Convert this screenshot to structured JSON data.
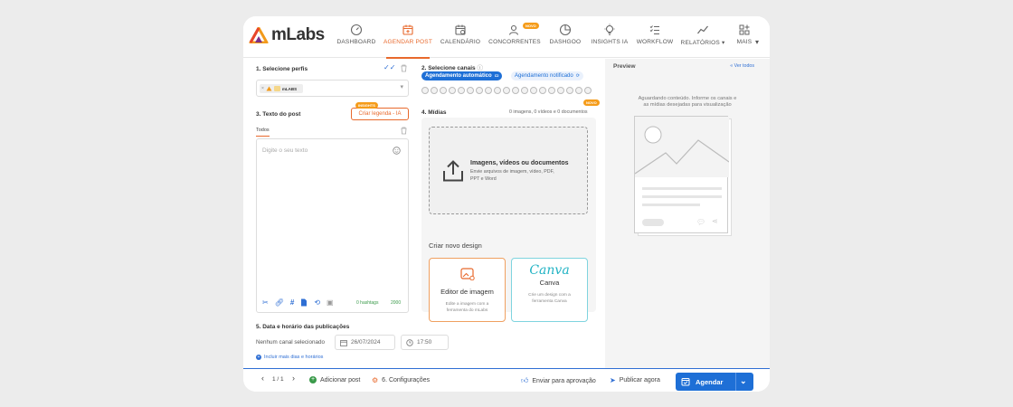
{
  "brand": {
    "name": "mLabs"
  },
  "nav": [
    {
      "label": "DASHBOARD",
      "icon": "dashboard-icon"
    },
    {
      "label": "AGENDAR POST",
      "icon": "calendar-plus-icon",
      "active": true
    },
    {
      "label": "CALENDÁRIO",
      "icon": "calendar-icon"
    },
    {
      "label": "CONCORRENTES",
      "icon": "user-search-icon",
      "badge": "NOVO"
    },
    {
      "label": "DASHGOO",
      "icon": "pie-chart-icon"
    },
    {
      "label": "INSIGHTS IA",
      "icon": "lightbulb-icon"
    },
    {
      "label": "WORKFLOW",
      "icon": "checklist-icon"
    },
    {
      "label": "RELATÓRIOS",
      "icon": "line-chart-icon"
    },
    {
      "label": "MAIS",
      "icon": "apps-icon"
    }
  ],
  "step1": {
    "title": "1. Selecione perfis",
    "profile_name": "mLABS"
  },
  "step2": {
    "title": "2. Selecione canais",
    "tab_auto": "Agendamento automático",
    "tab_notified": "Agendamento notificado"
  },
  "step3": {
    "title": "3. Texto do post",
    "caption_button": "Criar legenda - IA",
    "caption_badge": "INSIGHTS",
    "tab_all": "Todos",
    "placeholder": "Digite o seu texto",
    "hashtags": "0 hashtags",
    "char_count": "2000"
  },
  "step4": {
    "title": "4. Mídias",
    "badge": "NOVO",
    "count": "0 imagens, 0 vídeos e 0 documentos",
    "drop_title": "Imagens, vídeos ou documentos",
    "drop_desc1": "Envie arquivos de imagem, vídeo, PDF,",
    "drop_desc2": "PPT e Word",
    "design_title": "Criar novo design",
    "editor_title": "Editor de imagem",
    "editor_desc1": "Edite a imagem com a",
    "editor_desc2": "ferramenta do mLabs",
    "canva_logo": "Canva",
    "canva_title": "Canva",
    "canva_desc1": "Crie um design com a",
    "canva_desc2": "ferramenta Canva"
  },
  "step5": {
    "title": "5. Data e horário das publicações",
    "no_channel": "Nenhum canal selecionado",
    "date": "26/07/2024",
    "time": "17:50",
    "more_days": "Incluir mais dias e horários"
  },
  "preview": {
    "title": "Preview",
    "see_all": "Ver todos",
    "msg1": "Aguardando conteúdo. Informe os canais e",
    "msg2": "as mídias desejadas para visualização"
  },
  "footer": {
    "page": "1 / 1",
    "add_post": "Adicionar post",
    "settings": "6. Configurações",
    "send_approval": "Enviar para aprovação",
    "publish_now": "Publicar agora",
    "schedule": "Agendar"
  },
  "colors": {
    "accent": "#e8692c",
    "primary": "#1e6fd6",
    "canva": "#22b3c4"
  }
}
